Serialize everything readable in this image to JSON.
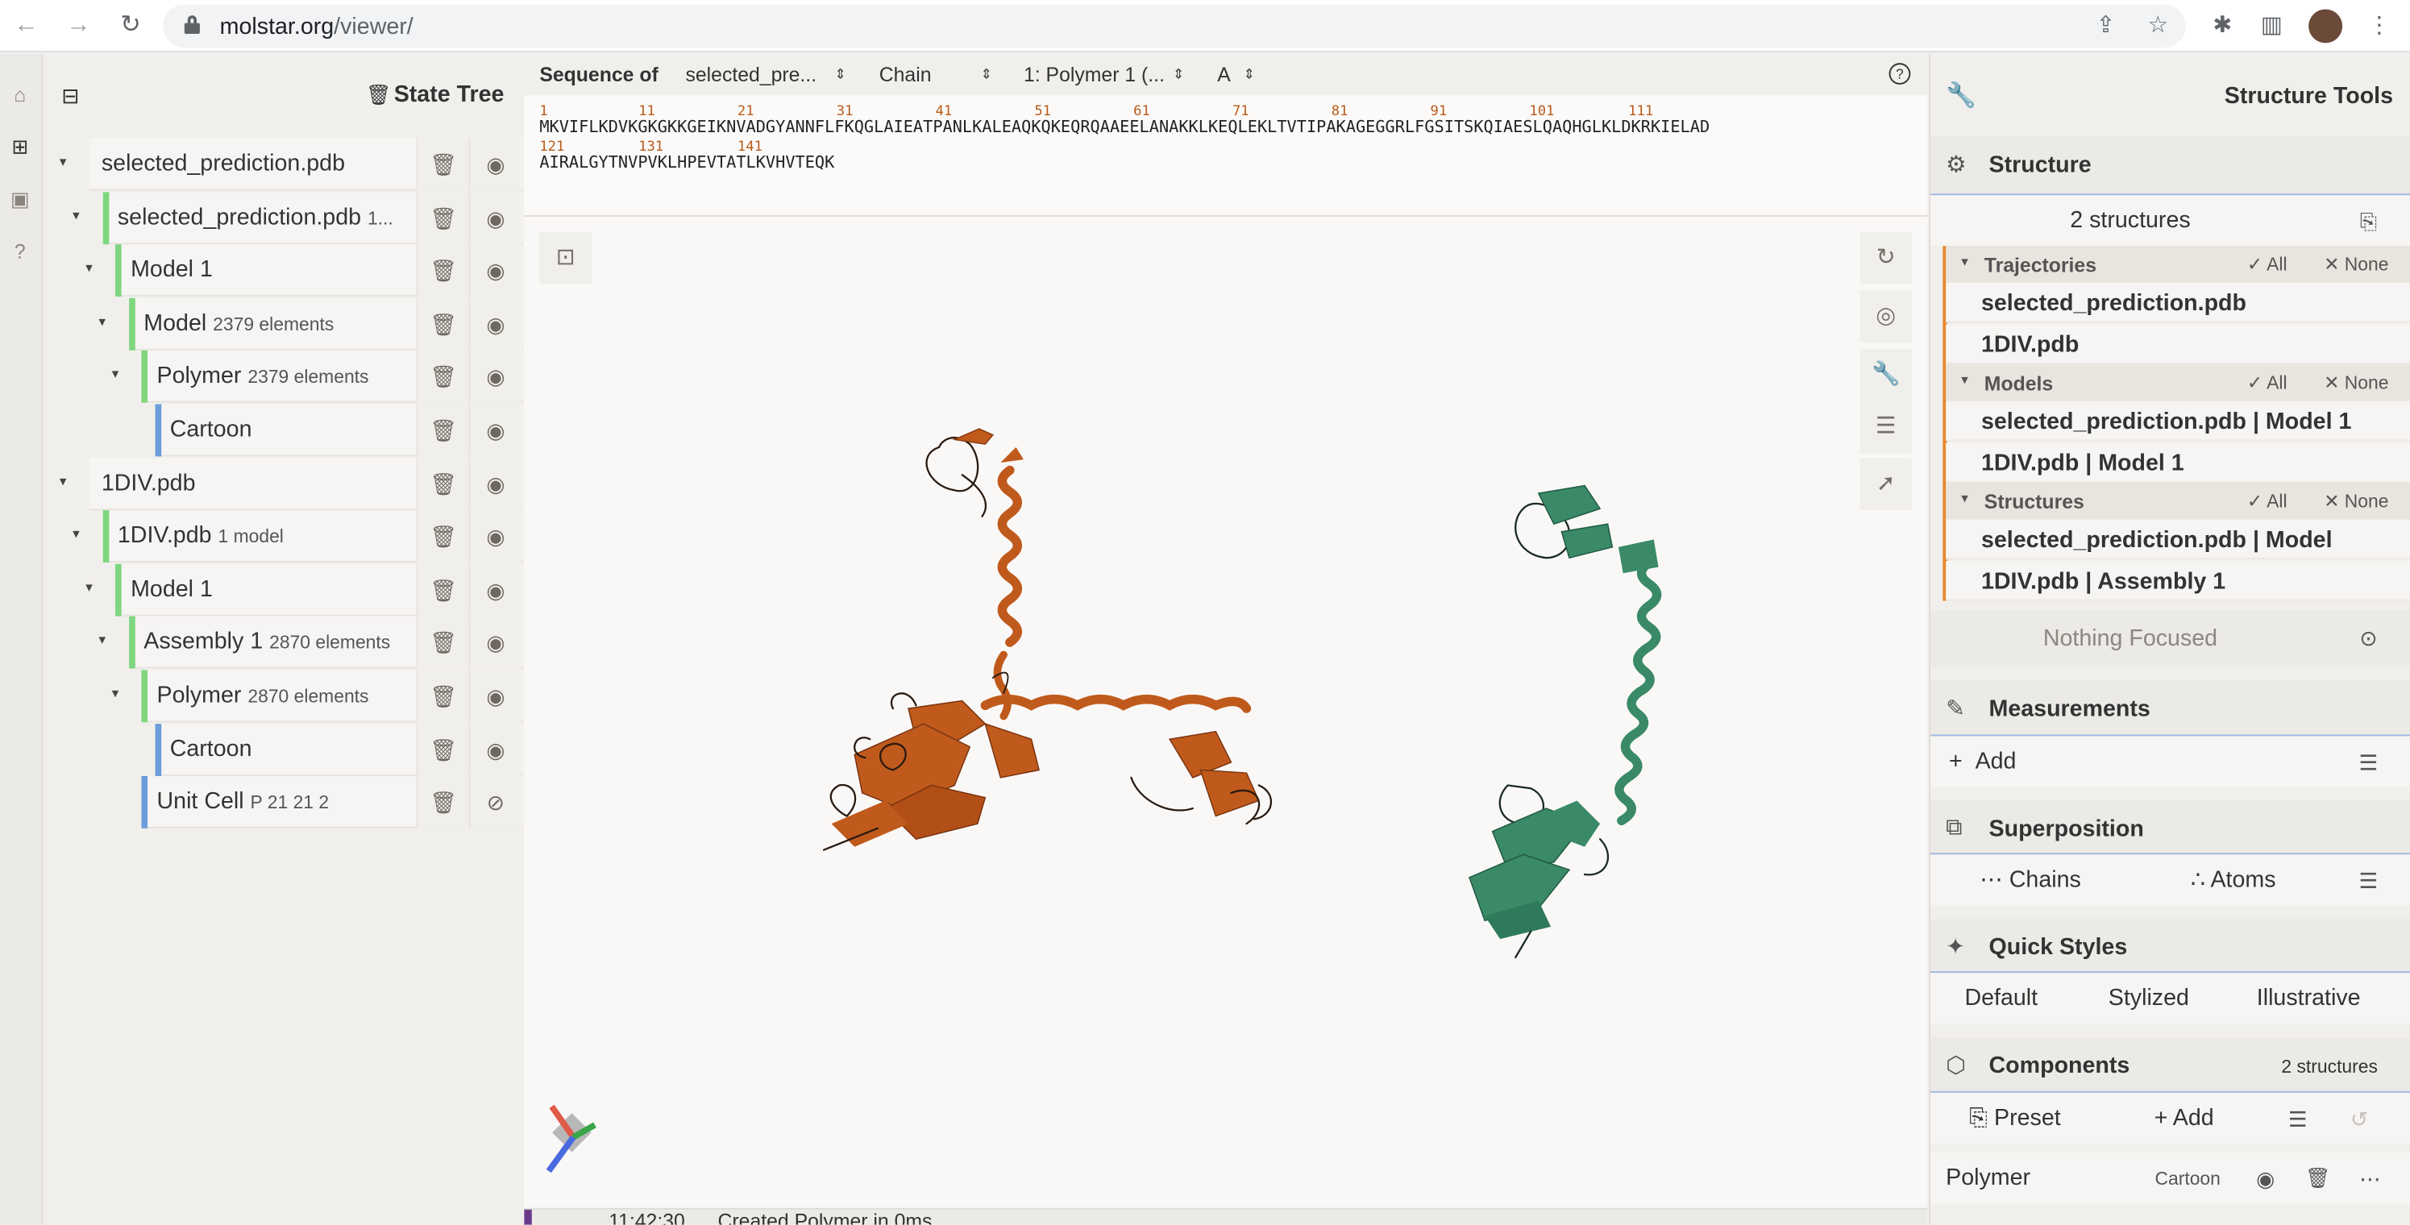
{
  "browser": {
    "url_host": "molstar.org",
    "url_path": "/viewer/"
  },
  "state_tree": {
    "title": "State Tree",
    "rows": [
      {
        "label": "selected_prediction.pdb",
        "detail": ""
      },
      {
        "label": "selected_prediction.pdb",
        "detail": "1..."
      },
      {
        "label": "Model 1",
        "detail": ""
      },
      {
        "label": "Model",
        "detail": "2379 elements"
      },
      {
        "label": "Polymer",
        "detail": "2379 elements"
      },
      {
        "label": "Cartoon",
        "detail": ""
      },
      {
        "label": "1DIV.pdb",
        "detail": ""
      },
      {
        "label": "1DIV.pdb",
        "detail": "1 model"
      },
      {
        "label": "Model 1",
        "detail": ""
      },
      {
        "label": "Assembly 1",
        "detail": "2870 elements"
      },
      {
        "label": "Polymer",
        "detail": "2870 elements"
      },
      {
        "label": "Cartoon",
        "detail": ""
      },
      {
        "label": "Unit Cell",
        "detail": "P 21 21 2"
      }
    ]
  },
  "sequence": {
    "label": "Sequence of",
    "structure_select": "selected_pre...",
    "mode_select": "Chain",
    "entity_select": "1: Polymer 1 (...",
    "chain_select": "A",
    "line1": "MKVIFLKDVKGKGKKGEIKNVADGYANNFLFKQGLAIEATPANLKALEAQKQKEQRQAAEELANAKKLKEQLEKLTVTIPAKAGEGGRLFGSITSKQIAESLQAQHGLKLDKRKIELAD",
    "line2": "AIRALGYTNVPVKLHPEVTATLKVHVTEQK",
    "nums1": [
      "1",
      "11",
      "21",
      "31",
      "41",
      "51",
      "61",
      "71",
      "81",
      "91",
      "101",
      "111"
    ],
    "nums2": [
      "121",
      "131",
      "141"
    ]
  },
  "log": {
    "time": "11:42:30",
    "message": "Created Polymer in 0ms"
  },
  "tools": {
    "title": "Structure Tools",
    "structure": {
      "title": "Structure",
      "count": "2 structures",
      "groups": [
        {
          "title": "Trajectories",
          "all": "All",
          "none": "None",
          "items": [
            "selected_prediction.pdb",
            "1DIV.pdb"
          ]
        },
        {
          "title": "Models",
          "all": "All",
          "none": "None",
          "items": [
            "selected_prediction.pdb | Model 1",
            "1DIV.pdb | Model 1"
          ]
        },
        {
          "title": "Structures",
          "all": "All",
          "none": "None",
          "items": [
            "selected_prediction.pdb | Model",
            "1DIV.pdb | Assembly 1"
          ]
        }
      ],
      "focus": "Nothing Focused"
    },
    "measurements": {
      "title": "Measurements",
      "add": "Add"
    },
    "superposition": {
      "title": "Superposition",
      "chains": "Chains",
      "atoms": "Atoms"
    },
    "quick_styles": {
      "title": "Quick Styles",
      "default": "Default",
      "stylized": "Stylized",
      "illustrative": "Illustrative"
    },
    "components": {
      "title": "Components",
      "count": "2 structures",
      "preset": "Preset",
      "add": "Add",
      "item_label": "Polymer",
      "item_repr": "Cartoon"
    }
  },
  "colors": {
    "orange_structure": "#c05a1c",
    "green_structure": "#3a8a68",
    "accent": "#e8892e",
    "tree_green": "#7fd67f",
    "tree_blue": "#6a9ed8"
  }
}
